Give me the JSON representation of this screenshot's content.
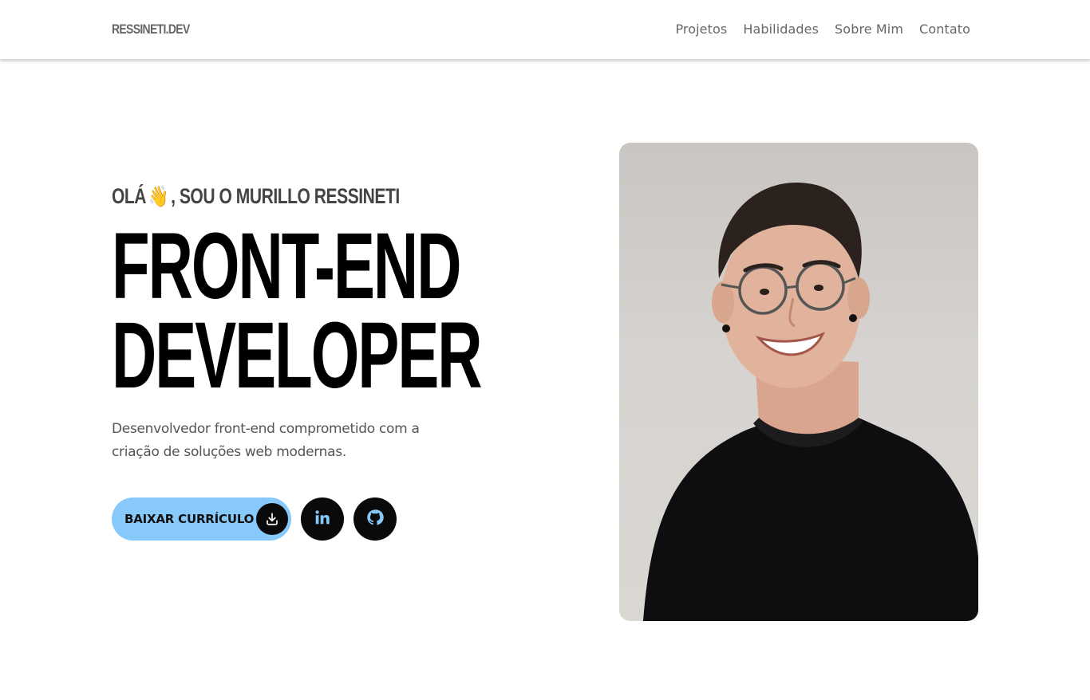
{
  "header": {
    "logo": "RESSINETI.DEV",
    "nav": [
      {
        "label": "Projetos"
      },
      {
        "label": "Habilidades"
      },
      {
        "label": "Sobre Mim"
      },
      {
        "label": "Contato"
      }
    ]
  },
  "hero": {
    "greeting_pre": "OLÁ",
    "greeting_emoji": "👋",
    "greeting_post": ", SOU O MURILLO RESSINETI",
    "title_line1": "FRONT-END",
    "title_line2": "DEVELOPER",
    "description": "Desenvolvedor front-end comprometido com a criação de soluções web modernas.",
    "cv_button_label": "BAIXAR CURRÍCULO",
    "icons": {
      "download": "download-icon",
      "linkedin": "linkedin-icon",
      "github": "github-icon"
    }
  },
  "colors": {
    "accent": "#87c9fb",
    "dark": "#0a0a0a"
  }
}
